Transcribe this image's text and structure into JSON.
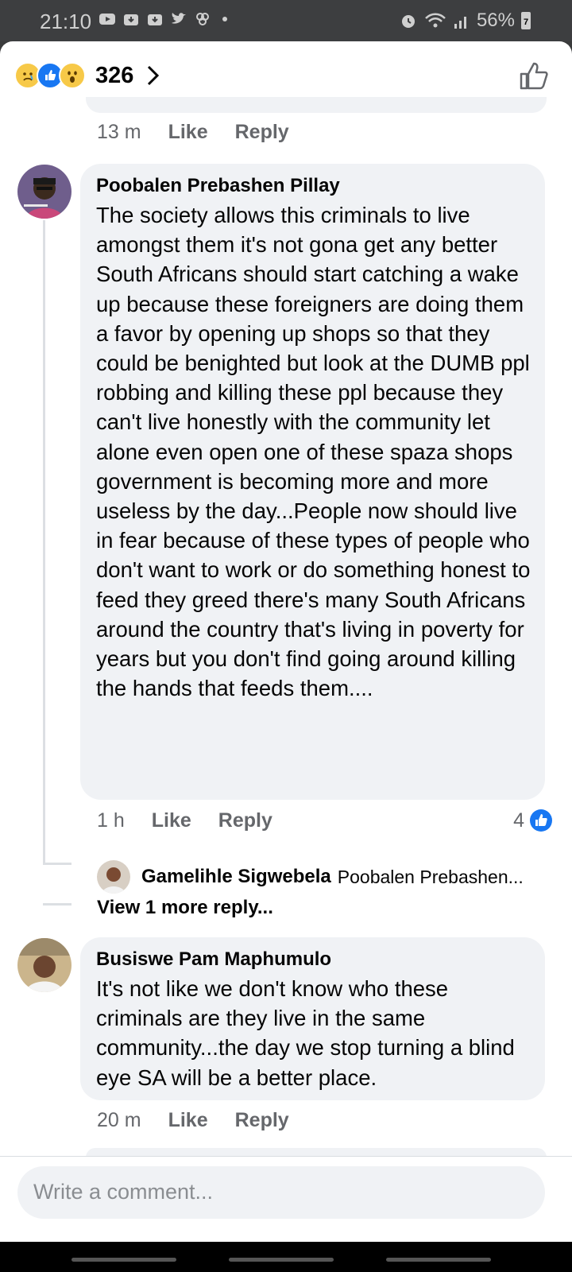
{
  "status_bar": {
    "time": "21:10",
    "battery": "56%",
    "battery_badge": "7"
  },
  "header": {
    "reaction_count": "326",
    "reaction_icons": [
      "sad-emoji",
      "like-emoji",
      "wow-emoji"
    ]
  },
  "previous_comment": {
    "time": "13 m",
    "like_label": "Like",
    "reply_label": "Reply"
  },
  "comments": [
    {
      "author": "Poobalen Prebashen Pillay",
      "text": "The society allows this criminals to live amongst them it's not gona get any better South Africans should start catching a wake up because these foreigners are doing them a favor by opening up shops so that they could be benighted but look at the DUMB ppl robbing and killing these ppl because they can't live honestly with the community let alone even open one of these spaza shops government is becoming more and more useless by the day...People now should live in fear because of these types of people who don't want to work or do something honest to feed they greed there's many South Africans around the country that's living in poverty for years but you don't find going around killing the hands that feeds them....",
      "time": "1 h",
      "like_label": "Like",
      "reply_label": "Reply",
      "likes": "4",
      "reply_preview": {
        "author": "Gamelihle Sigwebela",
        "text": "Poobalen Prebashen..."
      },
      "view_more": "View 1 more reply..."
    },
    {
      "author": "Busiswe Pam Maphumulo",
      "text": "It's not like we don't know who these criminals are they live in the same community...the day we stop turning a blind eye SA will be a better place.",
      "time": "20 m",
      "like_label": "Like",
      "reply_label": "Reply"
    }
  ],
  "composer": {
    "placeholder": "Write a comment..."
  },
  "colors": {
    "bubble": "#f0f2f5",
    "meta": "#65676b",
    "accent": "#1877f2",
    "text": "#050505"
  }
}
